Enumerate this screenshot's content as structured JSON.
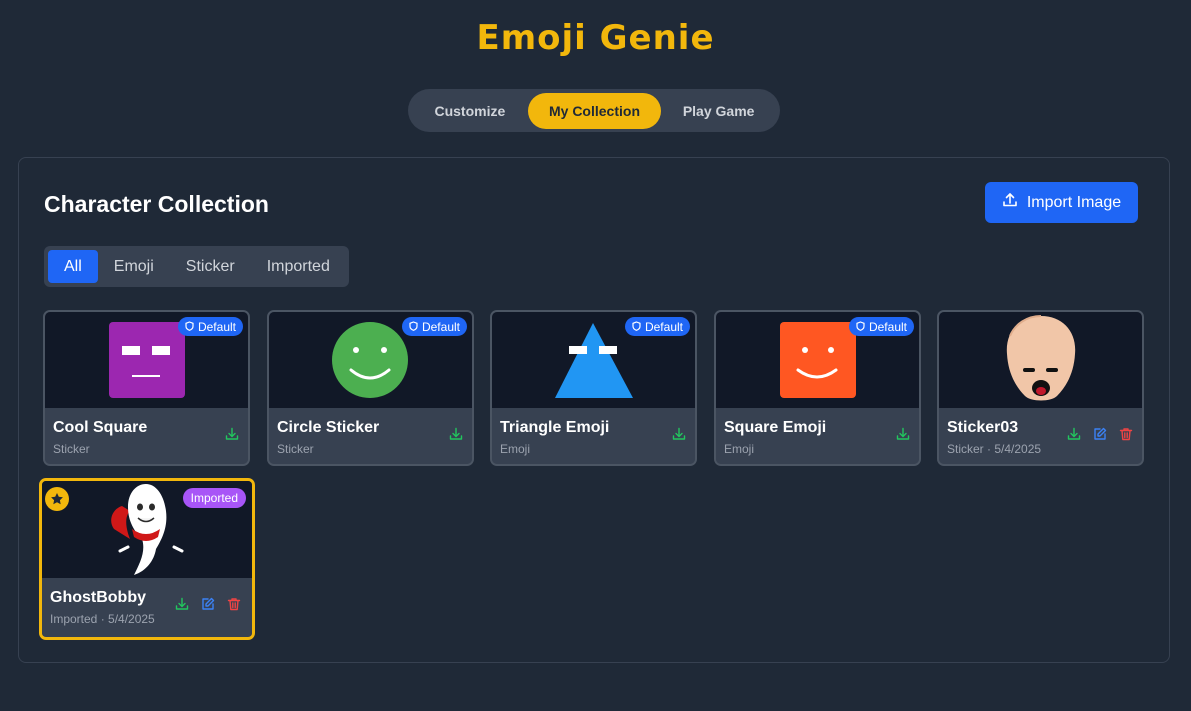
{
  "app": {
    "title": "Emoji Genie"
  },
  "tabs": [
    {
      "label": "Customize"
    },
    {
      "label": "My Collection"
    },
    {
      "label": "Play Game"
    }
  ],
  "collection": {
    "title": "Character Collection",
    "import_label": "Import Image",
    "filters": [
      "All",
      "Emoji",
      "Sticker",
      "Imported"
    ],
    "active_filter": "All",
    "items": [
      {
        "name": "Cool Square",
        "sub": "Sticker",
        "badge": "Default",
        "icon": "purple-square-face",
        "color": "#9c27b0"
      },
      {
        "name": "Circle Sticker",
        "sub": "Sticker",
        "badge": "Default",
        "icon": "green-circle-smiley",
        "color": "#4caf50"
      },
      {
        "name": "Triangle Emoji",
        "sub": "Emoji",
        "badge": "Default",
        "icon": "blue-triangle-face",
        "color": "#2196f3"
      },
      {
        "name": "Square Emoji",
        "sub": "Emoji",
        "badge": "Default",
        "icon": "orange-square-smiley",
        "color": "#ff5722"
      },
      {
        "name": "Sticker03",
        "sub": "Sticker · 5/4/2025",
        "badge": "",
        "icon": "bald-head-face"
      },
      {
        "name": "GhostBobby",
        "sub": "Imported · 5/4/2025",
        "badge": "Imported",
        "icon": "ghost-with-cape",
        "favorite": true
      }
    ]
  },
  "colors": {
    "accent": "#f2b70c",
    "primary": "#1f66f5",
    "imported_badge": "#a855f7",
    "download": "#22c55e",
    "edit": "#3b82f6",
    "delete": "#ef4444"
  }
}
